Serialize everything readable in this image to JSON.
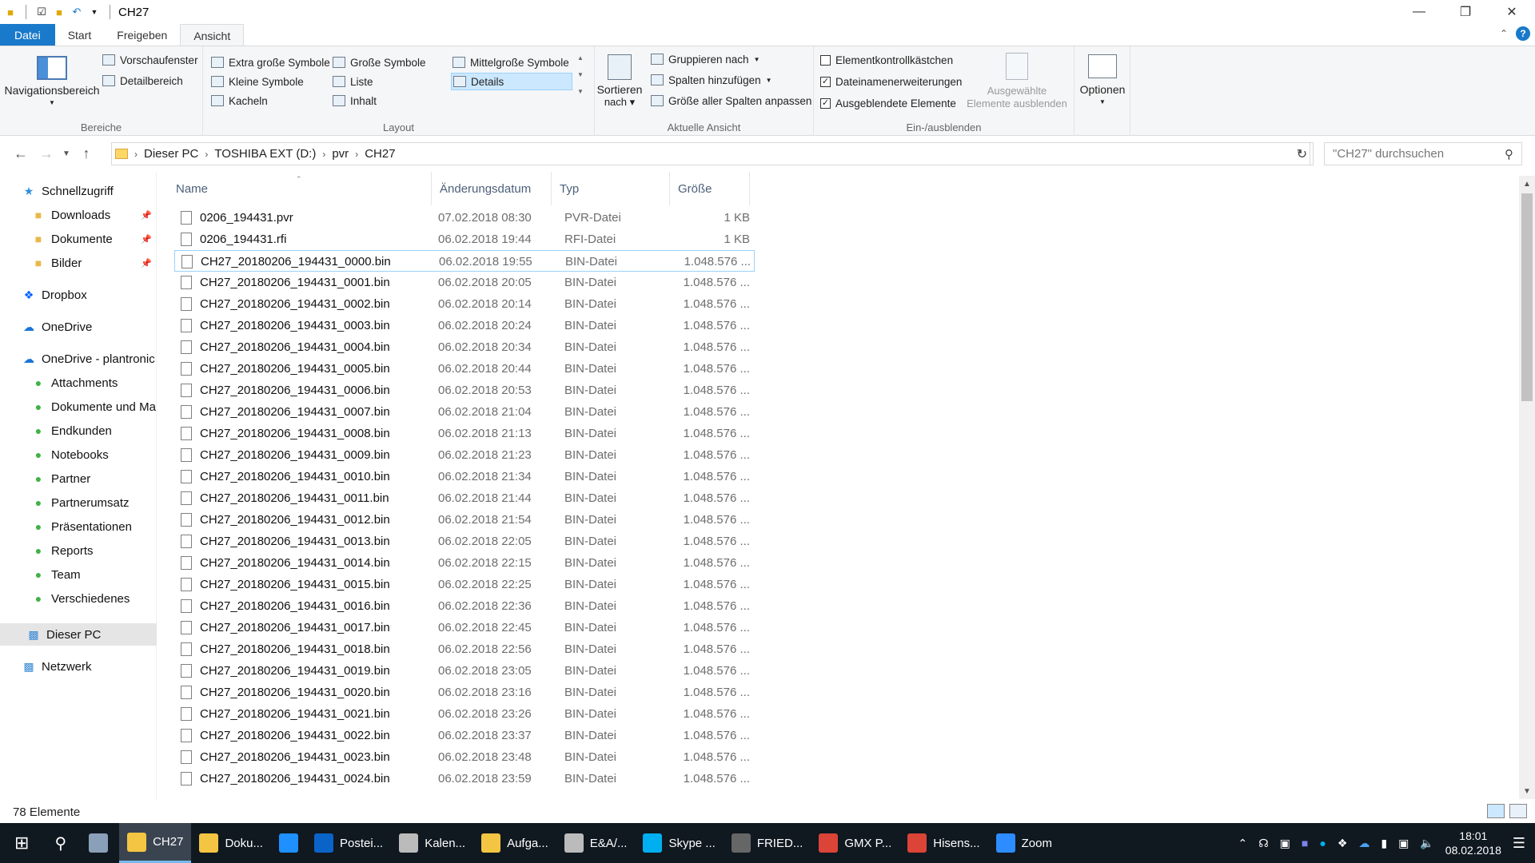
{
  "window": {
    "title": "CH27"
  },
  "tabs": [
    {
      "label": "Datei"
    },
    {
      "label": "Start"
    },
    {
      "label": "Freigeben"
    },
    {
      "label": "Ansicht"
    }
  ],
  "ribbon": {
    "bereiche": {
      "label": "Bereiche",
      "navigationsbereich": "Navigationsbereich",
      "vorschaufenster": "Vorschaufenster",
      "detailbereich": "Detailbereich"
    },
    "layout": {
      "label": "Layout",
      "options": [
        "Extra große Symbole",
        "Große Symbole",
        "Mittelgroße Symbole",
        "Kleine Symbole",
        "Liste",
        "Details",
        "Kacheln",
        "Inhalt"
      ],
      "selected": "Details"
    },
    "aktuelle_ansicht": {
      "label": "Aktuelle Ansicht",
      "sortieren": "Sortieren",
      "nach": "nach",
      "gruppieren": "Gruppieren nach",
      "spalten": "Spalten hinzufügen",
      "groesse": "Größe aller Spalten anpassen"
    },
    "ein_ausblenden": {
      "label": "Ein-/ausblenden",
      "elementkontrollkaestchen": "Elementkontrollkästchen",
      "dateinamenerweiterungen": "Dateinamenerweiterungen",
      "ausgeblendete": "Ausgeblendete Elemente",
      "ausgewaehlte_1": "Ausgewählte",
      "ausgewaehlte_2": "Elemente ausblenden"
    },
    "optionen": "Optionen"
  },
  "address": {
    "crumbs": [
      "Dieser PC",
      "TOSHIBA EXT (D:)",
      "pvr",
      "CH27"
    ],
    "search_placeholder": "\"CH27\" durchsuchen"
  },
  "sidebar": {
    "items": [
      {
        "label": "Schnellzugriff",
        "icon": "star-icon"
      },
      {
        "label": "Downloads",
        "icon": "download-folder-icon"
      },
      {
        "label": "Dokumente",
        "icon": "documents-folder-icon"
      },
      {
        "label": "Bilder",
        "icon": "pictures-folder-icon"
      },
      {
        "label": "Dropbox",
        "icon": "dropbox-icon"
      },
      {
        "label": "OneDrive",
        "icon": "cloud-icon"
      },
      {
        "label": "OneDrive - plantronic",
        "icon": "cloud-icon"
      },
      {
        "label": "Attachments",
        "icon": "synced-folder-icon"
      },
      {
        "label": "Dokumente und Ma",
        "icon": "synced-folder-icon"
      },
      {
        "label": "Endkunden",
        "icon": "synced-folder-icon"
      },
      {
        "label": "Notebooks",
        "icon": "synced-folder-icon"
      },
      {
        "label": "Partner",
        "icon": "synced-folder-icon"
      },
      {
        "label": "Partnerumsatz",
        "icon": "synced-folder-icon"
      },
      {
        "label": "Präsentationen",
        "icon": "synced-folder-icon"
      },
      {
        "label": "Reports",
        "icon": "synced-folder-icon"
      },
      {
        "label": "Team",
        "icon": "synced-folder-icon"
      },
      {
        "label": "Verschiedenes",
        "icon": "synced-folder-icon"
      },
      {
        "label": "Dieser PC",
        "icon": "computer-icon"
      },
      {
        "label": "Netzwerk",
        "icon": "network-icon"
      }
    ]
  },
  "columns": {
    "name": "Name",
    "date": "Änderungsdatum",
    "type": "Typ",
    "size": "Größe"
  },
  "files": [
    {
      "name": "0206_194431.pvr",
      "date": "07.02.2018 08:30",
      "type": "PVR-Datei",
      "size": "1 KB"
    },
    {
      "name": "0206_194431.rfi",
      "date": "06.02.2018 19:44",
      "type": "RFI-Datei",
      "size": "1 KB"
    },
    {
      "name": "CH27_20180206_194431_0000.bin",
      "date": "06.02.2018 19:55",
      "type": "BIN-Datei",
      "size": "1.048.576 ..."
    },
    {
      "name": "CH27_20180206_194431_0001.bin",
      "date": "06.02.2018 20:05",
      "type": "BIN-Datei",
      "size": "1.048.576 ..."
    },
    {
      "name": "CH27_20180206_194431_0002.bin",
      "date": "06.02.2018 20:14",
      "type": "BIN-Datei",
      "size": "1.048.576 ..."
    },
    {
      "name": "CH27_20180206_194431_0003.bin",
      "date": "06.02.2018 20:24",
      "type": "BIN-Datei",
      "size": "1.048.576 ..."
    },
    {
      "name": "CH27_20180206_194431_0004.bin",
      "date": "06.02.2018 20:34",
      "type": "BIN-Datei",
      "size": "1.048.576 ..."
    },
    {
      "name": "CH27_20180206_194431_0005.bin",
      "date": "06.02.2018 20:44",
      "type": "BIN-Datei",
      "size": "1.048.576 ..."
    },
    {
      "name": "CH27_20180206_194431_0006.bin",
      "date": "06.02.2018 20:53",
      "type": "BIN-Datei",
      "size": "1.048.576 ..."
    },
    {
      "name": "CH27_20180206_194431_0007.bin",
      "date": "06.02.2018 21:04",
      "type": "BIN-Datei",
      "size": "1.048.576 ..."
    },
    {
      "name": "CH27_20180206_194431_0008.bin",
      "date": "06.02.2018 21:13",
      "type": "BIN-Datei",
      "size": "1.048.576 ..."
    },
    {
      "name": "CH27_20180206_194431_0009.bin",
      "date": "06.02.2018 21:23",
      "type": "BIN-Datei",
      "size": "1.048.576 ..."
    },
    {
      "name": "CH27_20180206_194431_0010.bin",
      "date": "06.02.2018 21:34",
      "type": "BIN-Datei",
      "size": "1.048.576 ..."
    },
    {
      "name": "CH27_20180206_194431_0011.bin",
      "date": "06.02.2018 21:44",
      "type": "BIN-Datei",
      "size": "1.048.576 ..."
    },
    {
      "name": "CH27_20180206_194431_0012.bin",
      "date": "06.02.2018 21:54",
      "type": "BIN-Datei",
      "size": "1.048.576 ..."
    },
    {
      "name": "CH27_20180206_194431_0013.bin",
      "date": "06.02.2018 22:05",
      "type": "BIN-Datei",
      "size": "1.048.576 ..."
    },
    {
      "name": "CH27_20180206_194431_0014.bin",
      "date": "06.02.2018 22:15",
      "type": "BIN-Datei",
      "size": "1.048.576 ..."
    },
    {
      "name": "CH27_20180206_194431_0015.bin",
      "date": "06.02.2018 22:25",
      "type": "BIN-Datei",
      "size": "1.048.576 ..."
    },
    {
      "name": "CH27_20180206_194431_0016.bin",
      "date": "06.02.2018 22:36",
      "type": "BIN-Datei",
      "size": "1.048.576 ..."
    },
    {
      "name": "CH27_20180206_194431_0017.bin",
      "date": "06.02.2018 22:45",
      "type": "BIN-Datei",
      "size": "1.048.576 ..."
    },
    {
      "name": "CH27_20180206_194431_0018.bin",
      "date": "06.02.2018 22:56",
      "type": "BIN-Datei",
      "size": "1.048.576 ..."
    },
    {
      "name": "CH27_20180206_194431_0019.bin",
      "date": "06.02.2018 23:05",
      "type": "BIN-Datei",
      "size": "1.048.576 ..."
    },
    {
      "name": "CH27_20180206_194431_0020.bin",
      "date": "06.02.2018 23:16",
      "type": "BIN-Datei",
      "size": "1.048.576 ..."
    },
    {
      "name": "CH27_20180206_194431_0021.bin",
      "date": "06.02.2018 23:26",
      "type": "BIN-Datei",
      "size": "1.048.576 ..."
    },
    {
      "name": "CH27_20180206_194431_0022.bin",
      "date": "06.02.2018 23:37",
      "type": "BIN-Datei",
      "size": "1.048.576 ..."
    },
    {
      "name": "CH27_20180206_194431_0023.bin",
      "date": "06.02.2018 23:48",
      "type": "BIN-Datei",
      "size": "1.048.576 ..."
    },
    {
      "name": "CH27_20180206_194431_0024.bin",
      "date": "06.02.2018 23:59",
      "type": "BIN-Datei",
      "size": "1.048.576 ..."
    }
  ],
  "status": {
    "count": "78 Elemente"
  },
  "taskbar": {
    "items": [
      {
        "label": "CH27",
        "color": "#f4c542"
      },
      {
        "label": "Doku...",
        "color": "#f4c542"
      },
      {
        "label": "",
        "color": "#1e90ff"
      },
      {
        "label": "Postei...",
        "color": "#0a64c8"
      },
      {
        "label": "Kalen...",
        "color": "#bbbbbb"
      },
      {
        "label": "Aufga...",
        "color": "#f4c542"
      },
      {
        "label": "E&A/...",
        "color": "#bbbbbb"
      },
      {
        "label": "Skype ...",
        "color": "#00aff0"
      },
      {
        "label": "FRIED...",
        "color": "#666666"
      },
      {
        "label": "GMX P...",
        "color": "#db4437"
      },
      {
        "label": "Hisens...",
        "color": "#db4437"
      },
      {
        "label": "Zoom",
        "color": "#2d8cff"
      }
    ],
    "time": "18:01",
    "date": "08.02.2018"
  }
}
